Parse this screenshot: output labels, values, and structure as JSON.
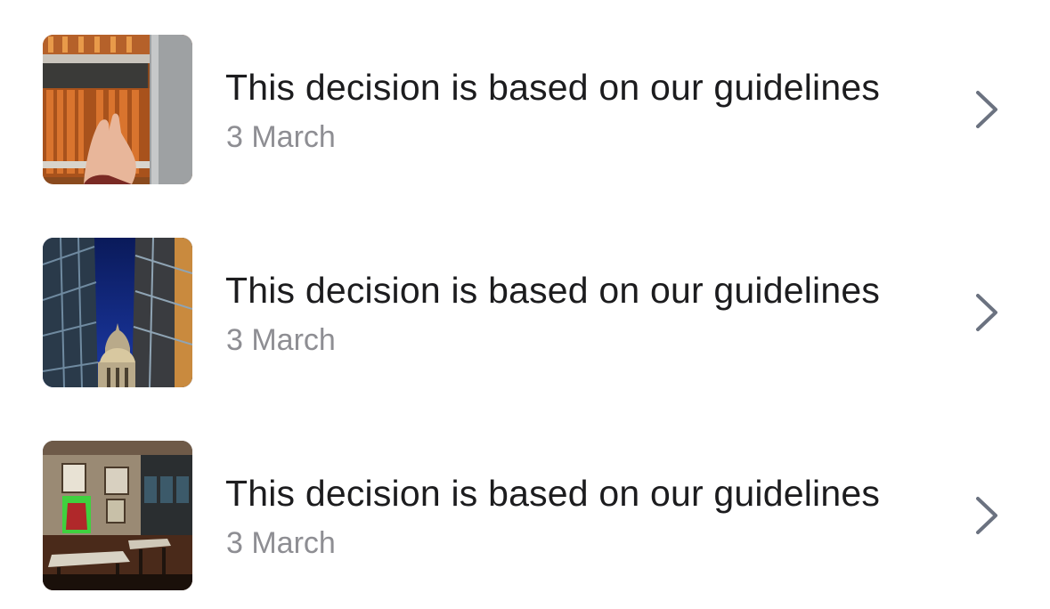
{
  "notifications": [
    {
      "title": "This decision is based on our guidelines",
      "date": "3 March",
      "icon": "chevron-right-icon",
      "thumbnail": "bookshelf-photo"
    },
    {
      "title": "This decision is based on our guidelines",
      "date": "3 March",
      "icon": "chevron-right-icon",
      "thumbnail": "cathedral-dome-photo"
    },
    {
      "title": "This decision is based on our guidelines",
      "date": "3 March",
      "icon": "chevron-right-icon",
      "thumbnail": "restaurant-interior-photo"
    }
  ],
  "colors": {
    "title": "#1c1c1e",
    "date": "#8e8e93",
    "chevron": "#6b7280",
    "background": "#ffffff"
  }
}
